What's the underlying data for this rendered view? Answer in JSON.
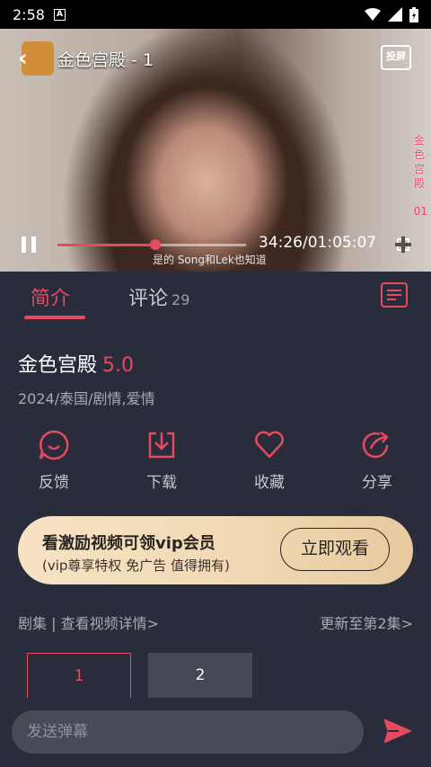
{
  "status_bar": {
    "time": "2:58",
    "notification_icon": "A"
  },
  "player": {
    "title": "金色宫殿 - 1",
    "cast_label": "投屏",
    "side_title_chars": [
      "金",
      "色",
      "宫",
      "殿"
    ],
    "side_episode": "01",
    "subtitle": "是的 Song和Lek也知道",
    "current_time": "34:26",
    "duration": "01:05:07",
    "time_display": "34:26/01:05:07",
    "progress_percent": 52,
    "state": "playing"
  },
  "tabs": {
    "intro": "简介",
    "comments": "评论",
    "comments_count": "29"
  },
  "drama": {
    "title": "金色宫殿",
    "score": "5.0",
    "meta": "2024/泰国/剧情,爱情"
  },
  "actions": [
    {
      "label": "反馈",
      "icon": "feedback-icon"
    },
    {
      "label": "下载",
      "icon": "download-icon"
    },
    {
      "label": "收藏",
      "icon": "heart-icon"
    },
    {
      "label": "分享",
      "icon": "share-icon"
    }
  ],
  "vip_banner": {
    "title": "看激励视频可领vip会员",
    "subtitle": "(vip尊享特权 免广告 值得拥有)",
    "button": "立即观看"
  },
  "episodes": {
    "left_label": "剧集 | 查看视频详情>",
    "right_label": "更新至第2集>",
    "items": [
      "1",
      "2"
    ],
    "selected": "1"
  },
  "danmaku": {
    "placeholder": "发送弹幕"
  },
  "colors": {
    "accent": "#e64a5f",
    "background": "#282c3b",
    "vip_gold": "#f0d8b2"
  }
}
